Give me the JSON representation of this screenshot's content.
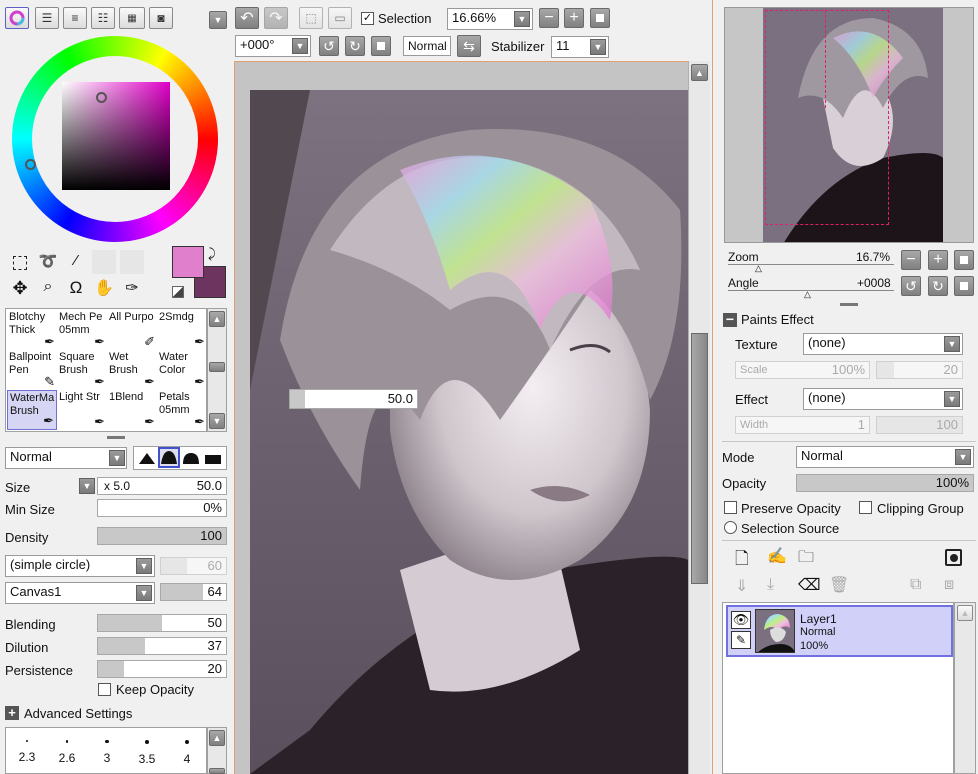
{
  "toolbar": {
    "selection_label": "Selection",
    "selection_checked": true,
    "zoom": "16.66%",
    "angle": "+000°",
    "blend": "Normal",
    "stabilizer_label": "Stabilizer",
    "stabilizer_value": "11"
  },
  "colors": {
    "primary": "#e080cc",
    "secondary": "#6e3460"
  },
  "brushes": [
    {
      "label": "Blotchy Thick",
      "icon": "✒"
    },
    {
      "label": "Mech Pe 05mm",
      "icon": "✒"
    },
    {
      "label": "All Purpo",
      "icon": "✐"
    },
    {
      "label": "2Smdg",
      "icon": "✒"
    },
    {
      "label": "Ballpoint Pen",
      "icon": "✎"
    },
    {
      "label": "Square Brush",
      "icon": "✒"
    },
    {
      "label": "Wet Brush",
      "icon": "✒"
    },
    {
      "label": "Water Color",
      "icon": "✒"
    },
    {
      "label": "WaterMa Brush",
      "icon": "✒"
    },
    {
      "label": "Light Str",
      "icon": "✒"
    },
    {
      "label": "1Blend",
      "icon": "✒"
    },
    {
      "label": "Petals 05mm",
      "icon": "✒"
    }
  ],
  "brush_settings": {
    "blend_mode": "Normal",
    "size_label": "Size",
    "size_mult": "x 5.0",
    "size_value": "50.0",
    "min_size_label": "Min Size",
    "min_size_value": "0%",
    "density_label": "Density",
    "density_value": "100",
    "shape": "(simple circle)",
    "shape_value": "60",
    "texture": "Canvas1",
    "texture_value": "64",
    "blending_label": "Blending",
    "blending_value": "50",
    "dilution_label": "Dilution",
    "dilution_value": "37",
    "persistence_label": "Persistence",
    "persistence_value": "20",
    "keep_opacity_label": "Keep Opacity",
    "advanced_label": "Advanced Settings"
  },
  "size_presets": [
    "2.3",
    "2.6",
    "3",
    "3.5",
    "4"
  ],
  "canvas": {
    "size_popup_value": "50.0"
  },
  "navigator": {
    "zoom_label": "Zoom",
    "zoom_value": "16.7%",
    "angle_label": "Angle",
    "angle_value": "+0008"
  },
  "paints_effect": {
    "title": "Paints Effect",
    "texture_label": "Texture",
    "texture_value": "(none)",
    "scale_label": "Scale",
    "scale_value": "100%",
    "scale_num": "20",
    "effect_label": "Effect",
    "effect_value": "(none)",
    "width_label": "Width",
    "width_value": "1",
    "width_num": "100"
  },
  "layer_props": {
    "mode_label": "Mode",
    "mode_value": "Normal",
    "opacity_label": "Opacity",
    "opacity_value": "100%",
    "preserve_label": "Preserve Opacity",
    "clipping_label": "Clipping Group",
    "selection_source_label": "Selection Source"
  },
  "layers": [
    {
      "name": "Layer1",
      "mode": "Normal",
      "opacity": "100%"
    }
  ]
}
